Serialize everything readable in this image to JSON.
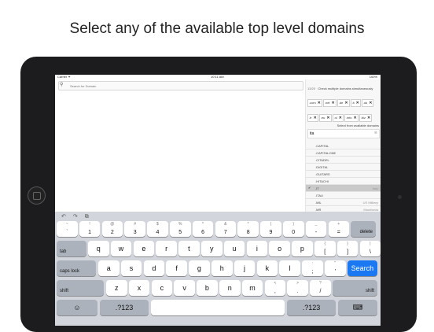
{
  "headline": "Select any of the available top level domains",
  "status": {
    "carrier": "Carrier ✦",
    "time": "10:11 AM",
    "battery": "100%"
  },
  "search": {
    "placeholder": "Search for Domain"
  },
  "right_panel": {
    "count": "13/20",
    "multi_label": "Check multiple domains simultaneously",
    "chips": [
      ".com",
      ".net",
      ".de",
      ".it",
      ".uk",
      ".fr",
      ".eu",
      ".nl",
      ".info",
      ".biz",
      ".nyc",
      ".it"
    ],
    "select_label": "Select from available domains",
    "filter_value": "ita",
    "list": [
      {
        "name": ".CAPITAL",
        "sub": ""
      },
      {
        "name": ".CAPITALONE",
        "sub": ""
      },
      {
        "name": ".CITADEL",
        "sub": ""
      },
      {
        "name": ".DIGITAL",
        "sub": ""
      },
      {
        "name": ".GUITARS",
        "sub": ""
      },
      {
        "name": ".HITACHI",
        "sub": ""
      },
      {
        "name": ".IT",
        "sub": "Italy",
        "selected": true
      },
      {
        "name": ".ITAU",
        "sub": ""
      },
      {
        "name": ".MIL",
        "sub": "US Military"
      },
      {
        "name": ".MR",
        "sub": "Mauritania"
      }
    ]
  },
  "keyboard": {
    "tools": [
      "↶",
      "↷",
      "⧉"
    ],
    "row1": [
      {
        "top": "~",
        "bot": "`"
      },
      {
        "top": "!",
        "bot": "1"
      },
      {
        "top": "@",
        "bot": "2"
      },
      {
        "top": "#",
        "bot": "3"
      },
      {
        "top": "$",
        "bot": "4"
      },
      {
        "top": "%",
        "bot": "5"
      },
      {
        "top": "^",
        "bot": "6"
      },
      {
        "top": "&",
        "bot": "7"
      },
      {
        "top": "*",
        "bot": "8"
      },
      {
        "top": "(",
        "bot": "9"
      },
      {
        "top": ")",
        "bot": "0"
      },
      {
        "top": "_",
        "bot": "-"
      },
      {
        "top": "+",
        "bot": "="
      }
    ],
    "delete": "delete",
    "tab": "tab",
    "row2": [
      "q",
      "w",
      "e",
      "r",
      "t",
      "y",
      "u",
      "i",
      "o",
      "p"
    ],
    "row2_extra": [
      {
        "top": "{",
        "bot": "["
      },
      {
        "top": "}",
        "bot": "]"
      },
      {
        "top": "|",
        "bot": "\\"
      }
    ],
    "caps": "caps lock",
    "row3": [
      "a",
      "s",
      "d",
      "f",
      "g",
      "h",
      "j",
      "k",
      "l"
    ],
    "row3_extra": [
      {
        "top": ":",
        "bot": ";"
      },
      {
        "top": "\"",
        "bot": "'"
      }
    ],
    "search": "Search",
    "shift": "shift",
    "row4": [
      "z",
      "x",
      "c",
      "v",
      "b",
      "n",
      "m"
    ],
    "row4_extra": [
      {
        "top": "<",
        "bot": ","
      },
      {
        "top": ">",
        "bot": "."
      },
      {
        "top": "?",
        "bot": "/"
      }
    ],
    "globe": "☺",
    "num": ".?123",
    "num2": ".?123",
    "kb_hide": "⌨"
  }
}
